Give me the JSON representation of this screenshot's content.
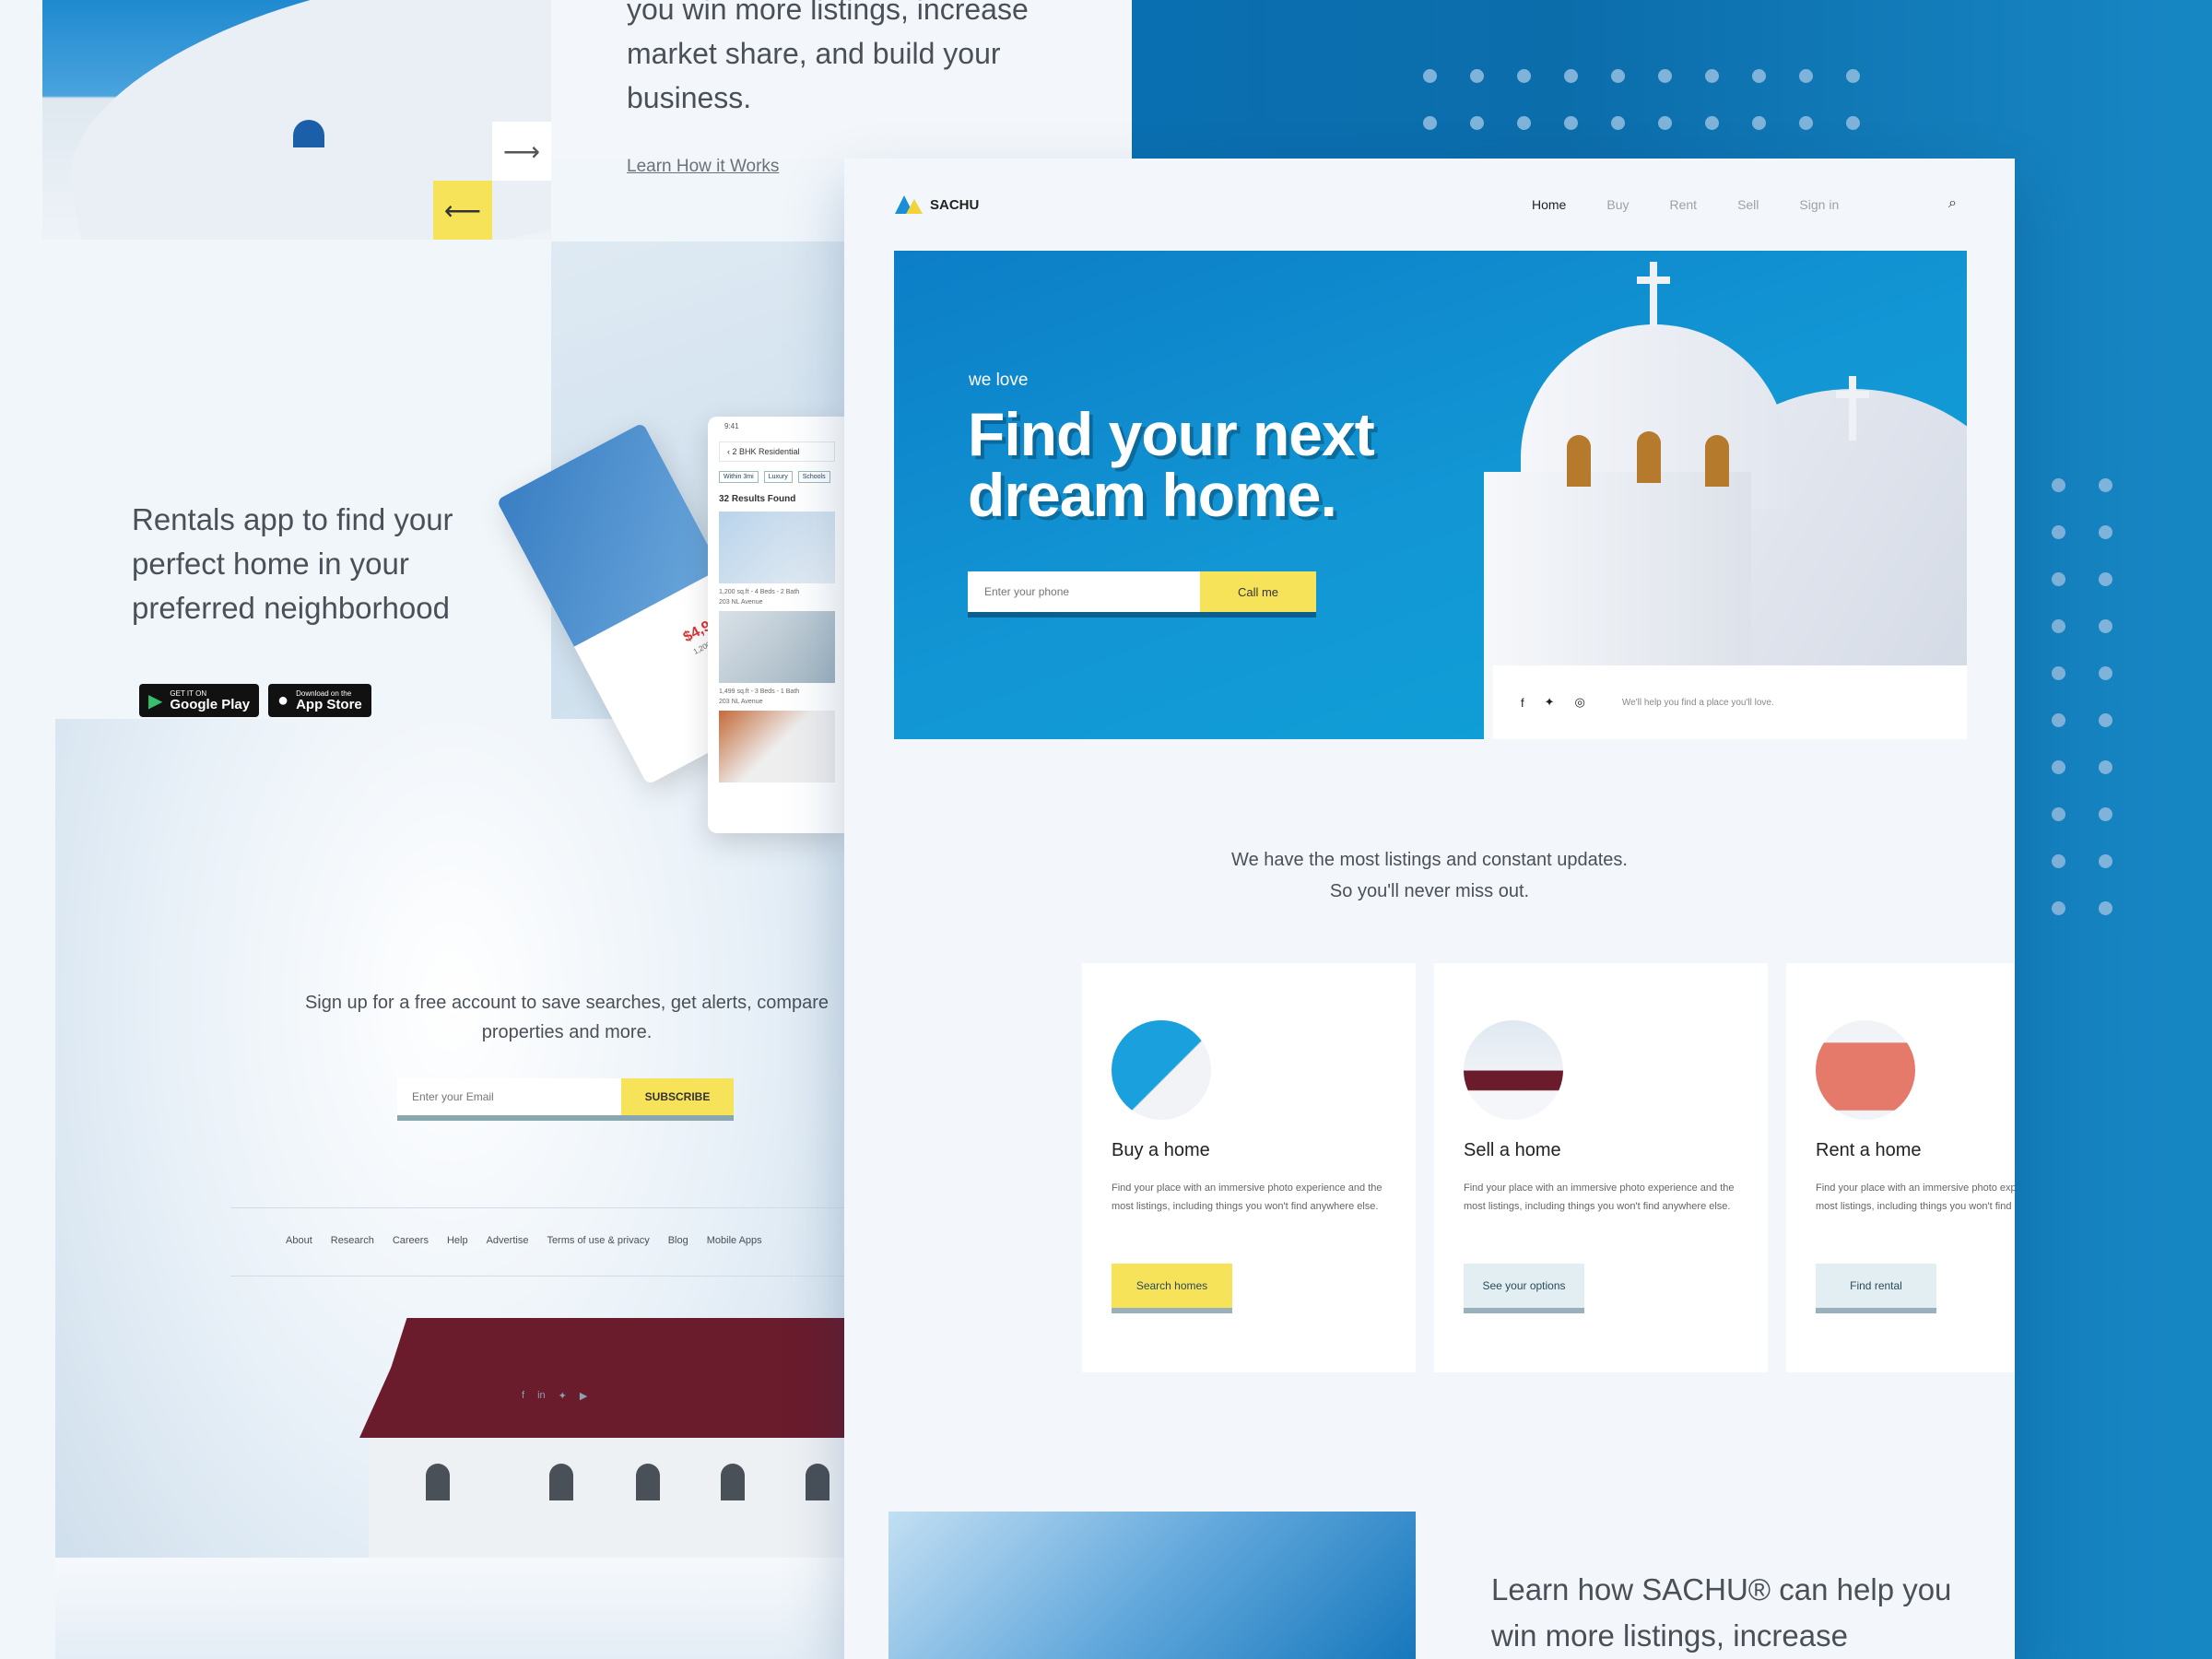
{
  "top_section": {
    "body_text": "you win more listings, increase market share, and build your business.",
    "learn_link": "Learn How it Works",
    "next_arrow": "⟶",
    "prev_arrow": "⟵"
  },
  "app_promo": {
    "text": "Rentals app to find your perfect home in  your preferred neighborhood",
    "google_play": {
      "small": "GET IT ON",
      "big": "Google Play"
    },
    "app_store": {
      "small": "Download on the",
      "big": "App Store"
    }
  },
  "phone_mock": {
    "status_time": "9:41",
    "search_value": "2 BHK Residential",
    "chips": [
      "Within 3mi",
      "Luxury",
      "Schools"
    ],
    "results_label": "32 Results Found",
    "listings": [
      {
        "meta": "1,200 sq.ft - 4 Beds - 2 Bath",
        "address": "203 NL Avenue"
      },
      {
        "meta": "1,499 sq.ft - 3 Beds - 1 Bath",
        "address": "203 NL Avenue"
      }
    ],
    "price": "$4,999",
    "price_sub": "1,200 sq.ft"
  },
  "signup": {
    "text": "Sign up for a free account to save searches, get alerts, compare properties and more.",
    "email_placeholder": "Enter your Email",
    "subscribe_label": "SUBSCRIBE"
  },
  "footer": {
    "links": [
      "About",
      "Research",
      "Careers",
      "Help",
      "Advertise",
      "Terms of use & privacy",
      "Blog",
      "Mobile Apps"
    ]
  },
  "main_page": {
    "brand": "SACHU",
    "nav": [
      "Home",
      "Buy",
      "Rent",
      "Sell",
      "Sign in"
    ],
    "active_nav": "Home",
    "hero": {
      "eyebrow": "we love",
      "headline_line1": "Find your next",
      "headline_line2": "dream home.",
      "phone_placeholder": "Enter your phone",
      "cta_label": "Call me",
      "social_icons": [
        "facebook-icon",
        "twitter-icon",
        "dribbble-icon"
      ],
      "tagline": "We'll help you find a place you'll love."
    },
    "listings_line1": "We have the most listings and constant updates.",
    "listings_line2": "So you'll never miss out.",
    "cards": [
      {
        "title": "Buy a home",
        "desc": "Find your place with an immersive photo experience and the most listings, including things you won't find anywhere else.",
        "button": "Search homes",
        "button_color": "#f7e35a"
      },
      {
        "title": "Sell a home",
        "desc": "Find your place with an immersive photo experience and the most listings, including things you won't find anywhere else.",
        "button": "See your options",
        "button_color": "#e3eef2"
      },
      {
        "title": "Rent a home",
        "desc": "Find your place with an immersive photo experience and the most listings, including things you won't find anywhere else.",
        "button": "Find rental",
        "button_color": "#e3eef2"
      }
    ],
    "bottom_text": "Learn how SACHU® can help you win more listings, increase"
  },
  "colors": {
    "accent_yellow": "#f7e35a",
    "brand_blue": "#0c7ec7",
    "background_blue": "#0a6fb0"
  }
}
